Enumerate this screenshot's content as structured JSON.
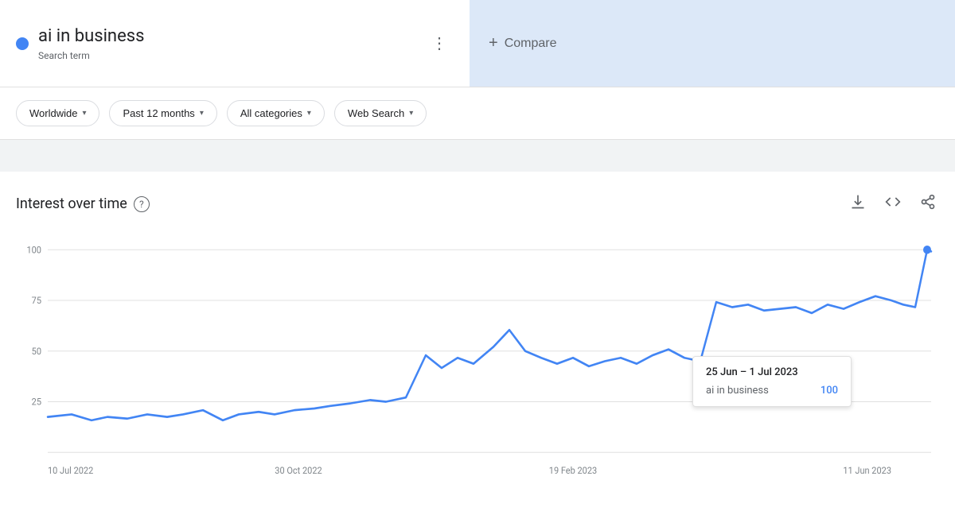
{
  "header": {
    "search_term": "ai in business",
    "term_type": "Search term",
    "dot_color": "#4285f4",
    "more_options_label": "⋮",
    "compare_label": "Compare",
    "compare_plus": "+"
  },
  "filters": {
    "region_label": "Worldwide",
    "period_label": "Past 12 months",
    "category_label": "All categories",
    "search_type_label": "Web Search",
    "chevron": "▾"
  },
  "chart": {
    "title": "Interest over time",
    "help_icon": "?",
    "download_icon": "↓",
    "embed_icon": "<>",
    "share_icon": "share",
    "y_labels": [
      "100",
      "75",
      "50",
      "25"
    ],
    "x_labels": [
      "10 Jul 2022",
      "30 Oct 2022",
      "19 Feb 2023",
      "11 Jun 2023"
    ],
    "tooltip": {
      "date_range": "25 Jun – 1 Jul 2023",
      "term": "ai in business",
      "value": "100"
    }
  }
}
